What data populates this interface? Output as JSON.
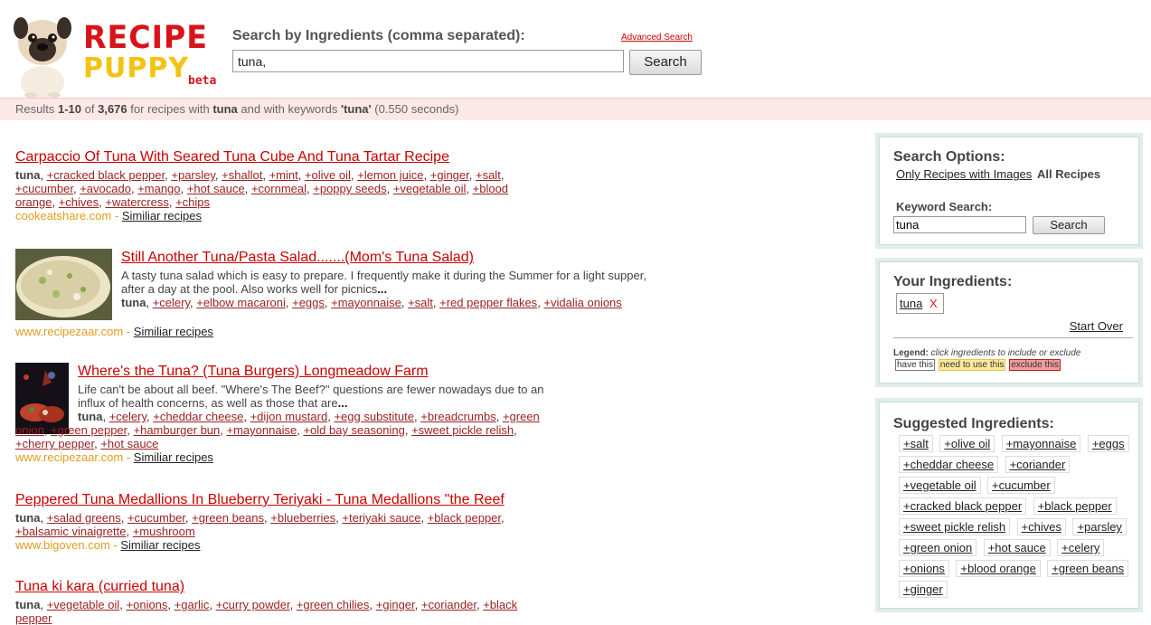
{
  "header": {
    "logo_top": "RECIPE",
    "logo_bottom": "PUPPY",
    "logo_beta": "beta",
    "search_label": "Search by Ingredients (comma separated):",
    "advanced_link": "Advanced Search",
    "search_value": "tuna,",
    "search_button": "Search"
  },
  "results_bar": {
    "prefix": "Results",
    "range": "1-10",
    "of": "of",
    "total": "3,676",
    "text1": "for recipes with",
    "ingredient": "tuna",
    "text2": "and with keywords",
    "keyword": "'tuna'",
    "time": "(0.550 seconds)"
  },
  "results": [
    {
      "title": "Carpaccio Of Tuna With Seared Tuna Cube And Tuna Tartar Recipe",
      "base": "tuna",
      "ingredients": [
        "+cracked black pepper",
        "+parsley",
        "+shallot",
        "+mint",
        "+olive oil",
        "+lemon juice",
        "+ginger",
        "+salt",
        "+cucumber",
        "+avocado",
        "+mango",
        "+hot sauce",
        "+cornmeal",
        "+poppy seeds",
        "+vegetable oil",
        "+blood orange",
        "+chives",
        "+watercress",
        "+chips"
      ],
      "source": "cookeatshare.com",
      "similar": "Similiar recipes"
    },
    {
      "title": "Still Another Tuna/Pasta Salad.......(Mom's Tuna Salad)",
      "description": "A tasty tuna salad which is easy to prepare. I frequently make it during the Summer for a light supper, after a day at the pool. Also works well for picnics",
      "ellipsis": "...",
      "base": "tuna",
      "ingredients": [
        "+celery",
        "+elbow macaroni",
        "+eggs",
        "+mayonnaise",
        "+salt",
        "+red pepper flakes",
        "+vidalia onions"
      ],
      "source": "www.recipezaar.com",
      "similar": "Similiar recipes"
    },
    {
      "title": "Where's the Tuna? (Tuna Burgers) Longmeadow Farm",
      "description": "Life can't be about all beef. \"Where's The Beef?\" questions are fewer nowadays due to an influx of health concerns, as well as those that are",
      "ellipsis": "...",
      "base": "tuna",
      "ingredients": [
        "+celery",
        "+cheddar cheese",
        "+dijon mustard",
        "+egg substitute",
        "+breadcrumbs",
        "+green onion",
        "+green pepper",
        "+hamburger bun",
        "+mayonnaise",
        "+old bay seasoning",
        "+sweet pickle relish",
        "+cherry pepper",
        "+hot sauce"
      ],
      "source": "www.recipezaar.com",
      "similar": "Similiar recipes"
    },
    {
      "title": "Peppered Tuna Medallions In Blueberry Teriyaki - Tuna Medallions \"the Reef",
      "base": "tuna",
      "ingredients": [
        "+salad greens",
        "+cucumber",
        "+green beans",
        "+blueberries",
        "+teriyaki sauce",
        "+black pepper",
        "+balsamic vinaigrette",
        "+mushroom"
      ],
      "source": "www.bigoven.com",
      "similar": "Similiar recipes"
    },
    {
      "title": "Tuna ki kara (curried tuna)",
      "base": "tuna",
      "ingredients": [
        "+vegetable oil",
        "+onions",
        "+garlic",
        "+curry powder",
        "+green chilies",
        "+ginger",
        "+coriander",
        "+black pepper"
      ]
    }
  ],
  "sidebar": {
    "options": {
      "title": "Search Options:",
      "only_images": "Only Recipes with Images",
      "all_recipes": "All Recipes",
      "keyword_label": "Keyword Search:",
      "keyword_value": "tuna",
      "search_button": "Search"
    },
    "your_ingredients": {
      "title": "Your Ingredients:",
      "item": "tuna",
      "remove": "X",
      "start_over": "Start Over",
      "legend_label": "Legend:",
      "legend_text": "click ingredients to include or exclude",
      "have": "have this",
      "need": "need to use this",
      "exclude": "exclude this"
    },
    "suggested": {
      "title": "Suggested Ingredients:",
      "rows": [
        [
          "+salt",
          "+olive oil",
          "+mayonnaise",
          "+eggs"
        ],
        [
          "+cheddar cheese",
          "+coriander"
        ],
        [
          "+vegetable oil",
          "+cucumber"
        ],
        [
          "+cracked black pepper",
          "+black pepper"
        ],
        [
          "+sweet pickle relish",
          "+chives",
          "+parsley"
        ],
        [
          "+green onion",
          "+hot sauce",
          "+celery"
        ],
        [
          "+onions",
          "+blood orange",
          "+green beans"
        ],
        [
          "+ginger"
        ]
      ]
    }
  },
  "colors": {
    "brand_red": "#d8141a",
    "brand_yellow": "#f4c212",
    "results_bar": "#fde8e8",
    "source": "#e39b1d",
    "panel_border": "#dfeeea"
  }
}
